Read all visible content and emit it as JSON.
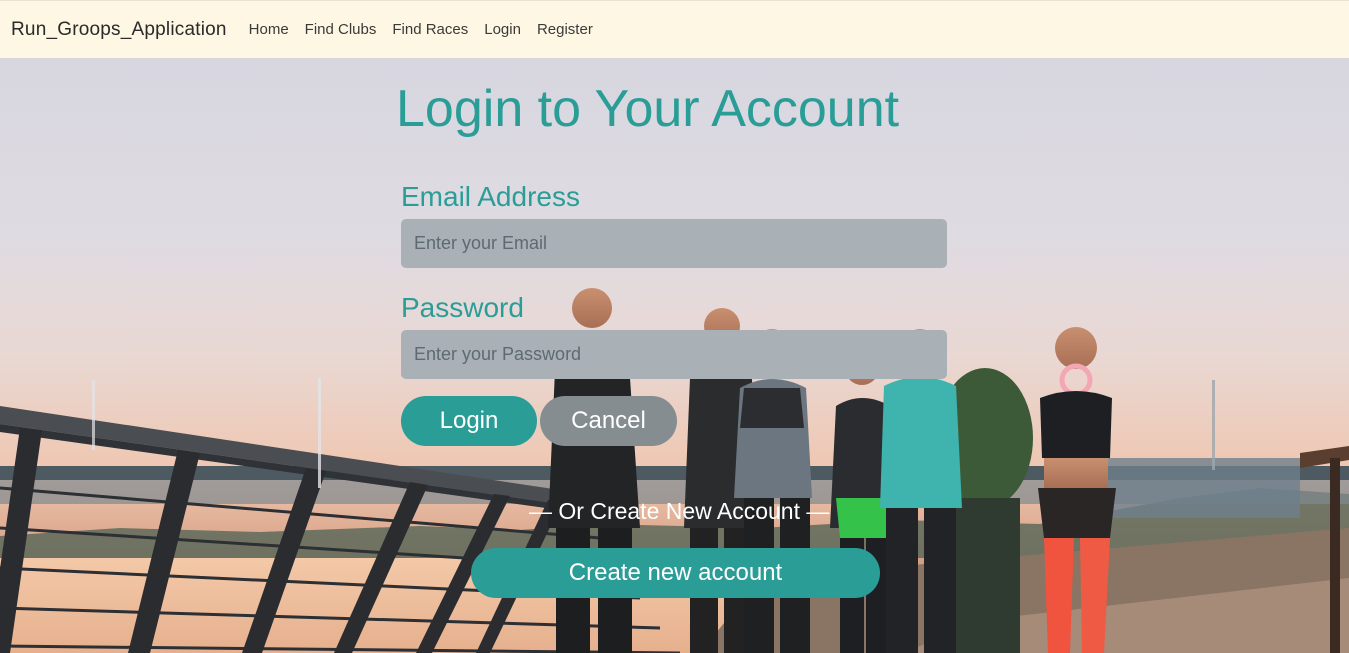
{
  "navbar": {
    "brand": "Run_Groops_Application",
    "links": [
      "Home",
      "Find Clubs",
      "Find Races",
      "Login",
      "Register"
    ]
  },
  "login": {
    "title": "Login to Your Account",
    "email_label": "Email Address",
    "email_placeholder": "Enter your Email",
    "password_label": "Password",
    "password_placeholder": "Enter your Password",
    "login_button": "Login",
    "cancel_button": "Cancel",
    "divider": "— Or Create New Account —",
    "create_button": "Create new account"
  },
  "colors": {
    "navbar_bg": "#fef7e3",
    "accent": "#2a9d97",
    "cancel": "#858d90",
    "input_bg": "#a9b0b6"
  },
  "background": {
    "description_icon": "runners-photo"
  }
}
